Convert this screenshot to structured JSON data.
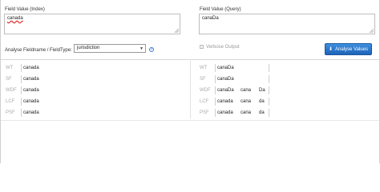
{
  "index_panel": {
    "label": "Field Value (Index)",
    "value": "canada"
  },
  "query_panel": {
    "label": "Field Value (Query)",
    "value": "canaDa"
  },
  "controls": {
    "fieldtype_label": "Analyse Fieldname / FieldType:",
    "fieldtype_value": "jurisdiction",
    "help_glyph": "?",
    "verbose_label": "Verbose Output",
    "analyse_button": "Analyse Values",
    "accent_color": "#2a6fc9"
  },
  "index_rows": [
    {
      "tag": "WT",
      "tokens": [
        "canada"
      ]
    },
    {
      "tag": "SF",
      "tokens": [
        "canada"
      ]
    },
    {
      "tag": "WDF",
      "tokens": [
        "canada"
      ]
    },
    {
      "tag": "LCF",
      "tokens": [
        "canada"
      ]
    },
    {
      "tag": "PSF",
      "tokens": [
        "canada"
      ]
    }
  ],
  "query_rows": [
    {
      "tag": "WT",
      "tokens": [
        "canaDa"
      ]
    },
    {
      "tag": "SF",
      "tokens": [
        "canaDa"
      ]
    },
    {
      "tag": "WDF",
      "tokens": [
        "canaDa",
        "cana",
        "Da"
      ]
    },
    {
      "tag": "LCF",
      "tokens": [
        "canada",
        "cana",
        "da"
      ]
    },
    {
      "tag": "PSF",
      "tokens": [
        "canada",
        "cana",
        "da"
      ]
    }
  ]
}
